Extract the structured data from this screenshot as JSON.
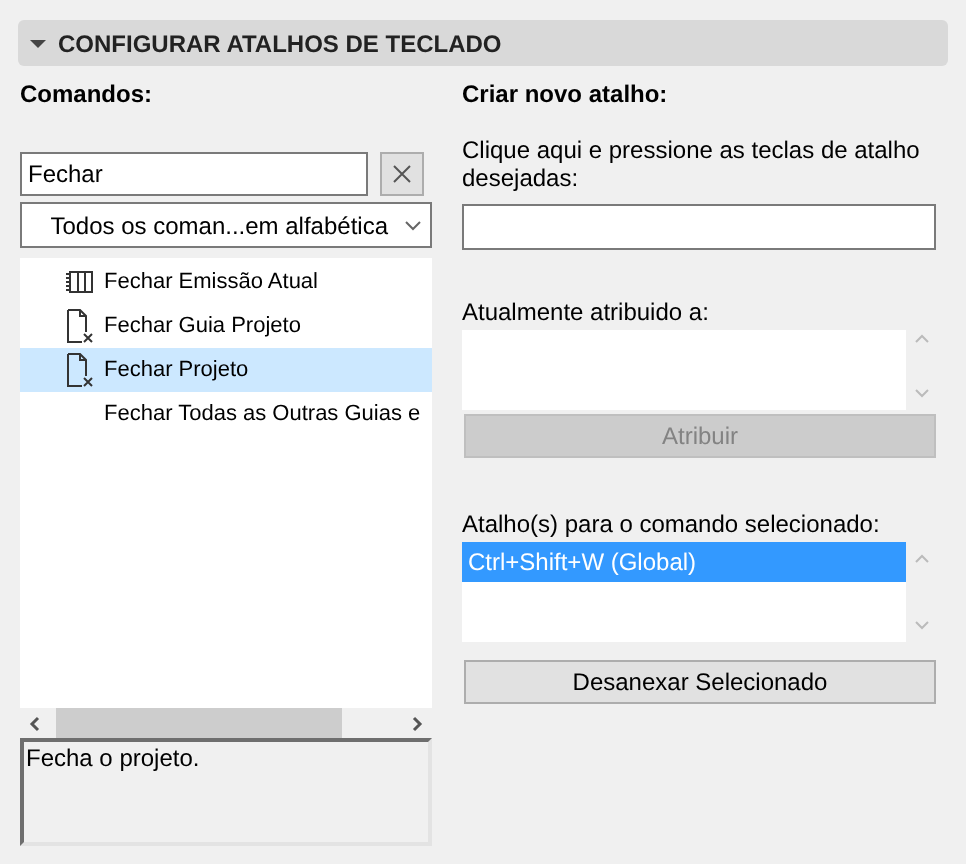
{
  "panel": {
    "title": "CONFIGURAR ATALHOS DE TECLADO",
    "expanded": true
  },
  "commands": {
    "label": "Comandos:",
    "search_value": "Fechar",
    "filter": "Todos os coman...em alfabética",
    "items": [
      {
        "label": "Fechar Emissão Atual",
        "kind": "columns",
        "selected": false
      },
      {
        "label": "Fechar Guia Projeto",
        "kind": "document",
        "selected": false
      },
      {
        "label": "Fechar Projeto",
        "kind": "document",
        "selected": true
      },
      {
        "label": "Fechar Todas as Outras Guias e",
        "kind": "plain",
        "selected": false
      }
    ],
    "description": "Fecha o projeto."
  },
  "new_shortcut": {
    "label": "Criar novo atalho:",
    "hint": "Clique aqui e pressione as teclas de atalho desejadas:",
    "assigned_label": "Atualmente atribuido a:",
    "assign_button": {
      "label": "Atribuir",
      "disabled": true
    },
    "shortcuts_label": "Atalho(s) para o comando selecionado:",
    "shortcuts": [
      {
        "label": "Ctrl+Shift+W (Global)",
        "selected": true
      }
    ],
    "detach_button": {
      "label": "Desanexar Selecionado",
      "disabled": false
    }
  }
}
